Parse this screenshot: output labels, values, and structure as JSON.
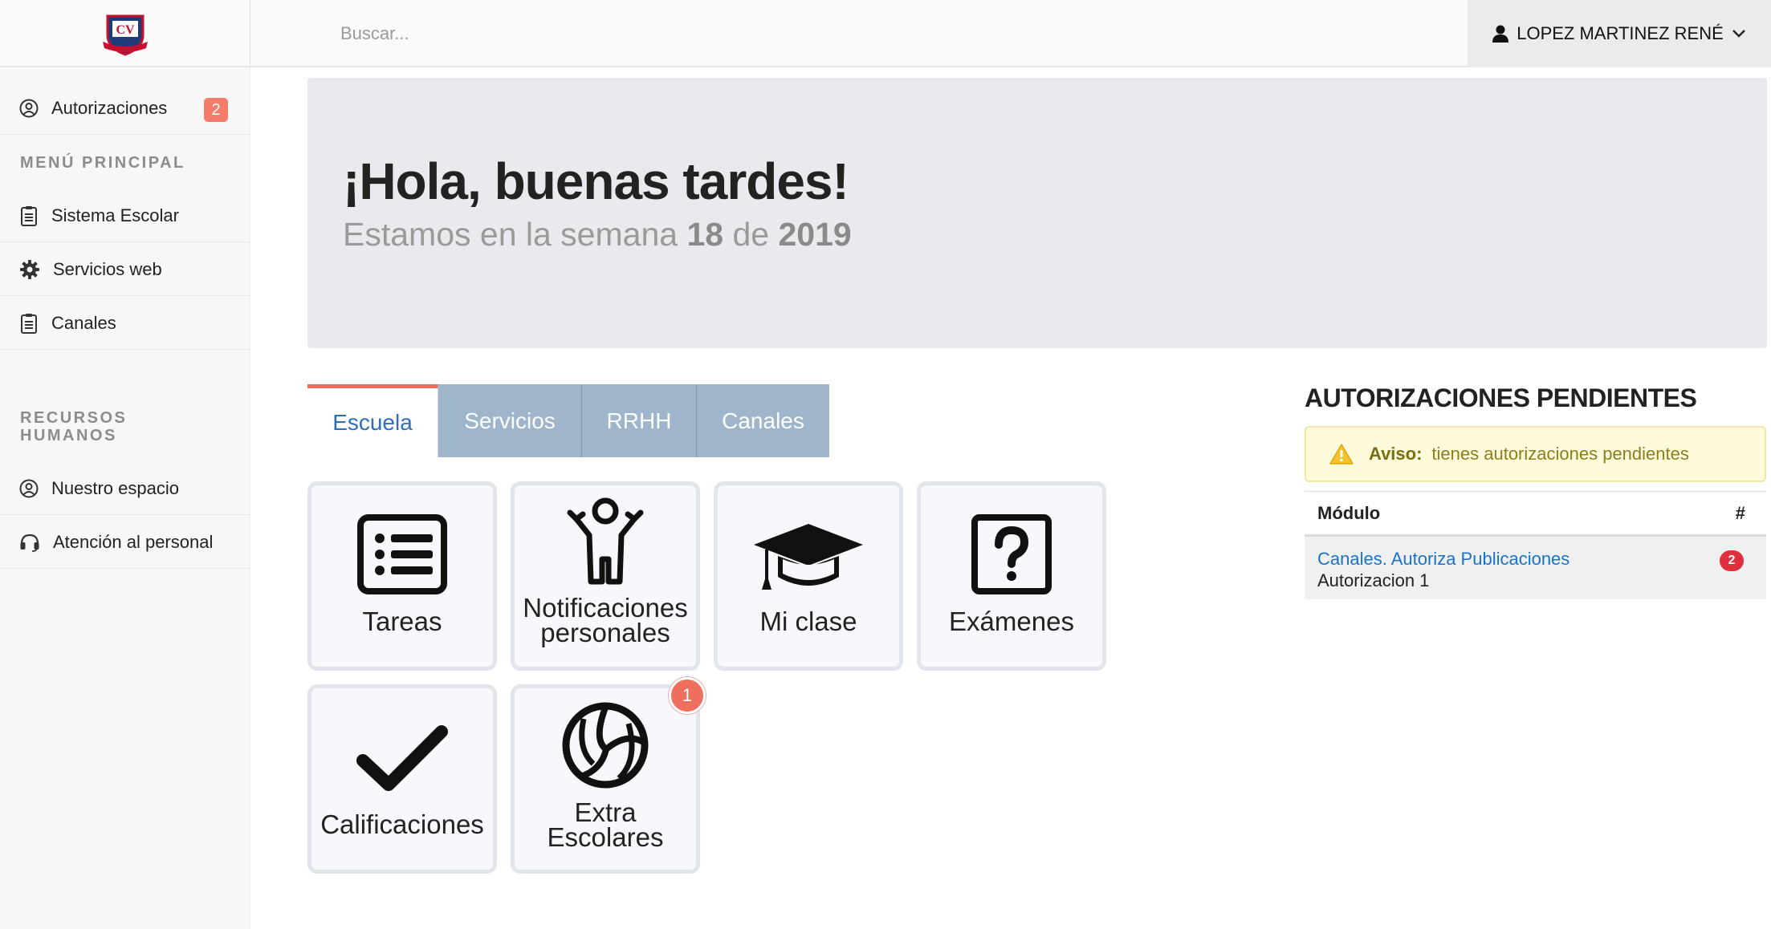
{
  "header": {
    "search_placeholder": "Buscar...",
    "user_name": "LOPEZ MARTINEZ RENÉ",
    "logo_letters": "CV"
  },
  "sidebar": {
    "authorizations": {
      "label": "Autorizaciones",
      "badge": "2",
      "icon": "user-circle-icon"
    },
    "section_main": "MENÚ PRINCIPAL",
    "main_items": [
      {
        "label": "Sistema Escolar",
        "icon": "clipboard-icon"
      },
      {
        "label": "Servicios web",
        "icon": "gear-icon"
      },
      {
        "label": "Canales",
        "icon": "clipboard-icon"
      }
    ],
    "section_hr_line1": "RECURSOS",
    "section_hr_line2": "HUMANOS",
    "hr_items": [
      {
        "label": "Nuestro espacio",
        "icon": "user-circle-icon"
      },
      {
        "label": "Atención al personal",
        "icon": "headset-icon"
      }
    ]
  },
  "hero": {
    "greeting": "¡Hola, buenas tardes!",
    "week_prefix": "Estamos en la semana",
    "week_number": "18",
    "week_of": "de",
    "year": "2019"
  },
  "tabs": [
    {
      "label": "Escuela",
      "active": true
    },
    {
      "label": "Servicios",
      "active": false
    },
    {
      "label": "RRHH",
      "active": false
    },
    {
      "label": "Canales",
      "active": false
    }
  ],
  "tiles": [
    {
      "line1": "Tareas",
      "line2": "",
      "icon": "list-icon"
    },
    {
      "line1": "Notificaciones",
      "line2": "personales",
      "icon": "child-icon"
    },
    {
      "line1": "Mi clase",
      "line2": "",
      "icon": "graduation-cap-icon"
    },
    {
      "line1": "Exámenes",
      "line2": "",
      "icon": "question-icon"
    },
    {
      "line1": "Calificaciones",
      "line2": "",
      "icon": "check-icon"
    },
    {
      "line1": "Extra",
      "line2": "Escolares",
      "icon": "volleyball-icon",
      "badge": "1"
    }
  ],
  "pending": {
    "title": "AUTORIZACIONES PENDIENTES",
    "alert_label": "Aviso:",
    "alert_text": "tienes autorizaciones pendientes",
    "col_module": "Módulo",
    "col_count": "#",
    "rows": [
      {
        "module": "Canales. Autoriza Publicaciones",
        "detail": "Autorizacion 1",
        "count": "2"
      }
    ]
  },
  "colors": {
    "accent_red": "#f06a5a",
    "tab_inactive": "#9fb5cc",
    "link_blue": "#1a73c9",
    "hero_bg": "#e8eaed"
  }
}
